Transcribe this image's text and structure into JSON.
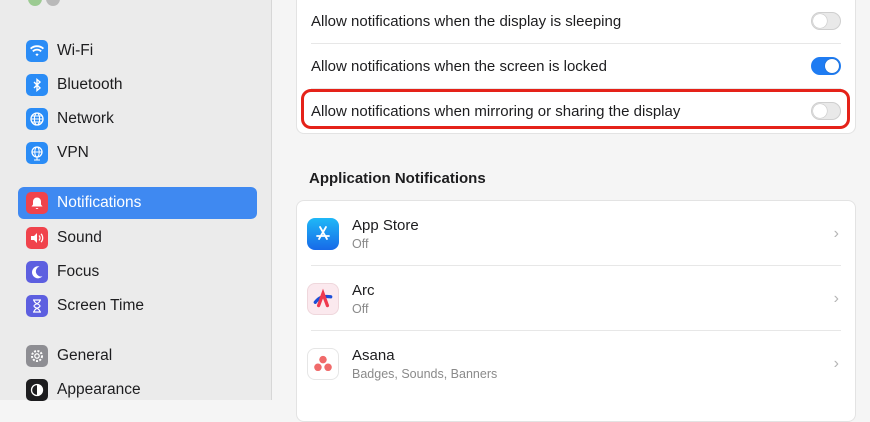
{
  "sidebar": {
    "items": [
      {
        "label": "Wi-Fi",
        "icon": "wifi-icon",
        "color": "#2a8cf6"
      },
      {
        "label": "Bluetooth",
        "icon": "bluetooth-icon",
        "color": "#2a8cf6"
      },
      {
        "label": "Network",
        "icon": "globe-icon",
        "color": "#2a8cf6"
      },
      {
        "label": "VPN",
        "icon": "vpn-globe-icon",
        "color": "#2a8cf6"
      },
      {
        "label": "Notifications",
        "icon": "bell-icon",
        "color": "#f0434c",
        "selected": true
      },
      {
        "label": "Sound",
        "icon": "speaker-icon",
        "color": "#f0434c"
      },
      {
        "label": "Focus",
        "icon": "moon-icon",
        "color": "#5d5fe0"
      },
      {
        "label": "Screen Time",
        "icon": "hourglass-icon",
        "color": "#5d5fe0"
      },
      {
        "label": "General",
        "icon": "gear-icon",
        "color": "#8e8e93"
      },
      {
        "label": "Appearance",
        "icon": "appearance-icon",
        "color": "#1d1d1f"
      }
    ]
  },
  "settings": [
    {
      "label": "Allow notifications when the display is sleeping",
      "on": false
    },
    {
      "label": "Allow notifications when the screen is locked",
      "on": true
    },
    {
      "label": "Allow notifications when mirroring or sharing the display",
      "on": false,
      "highlighted": true
    }
  ],
  "app_section": {
    "title": "Application Notifications",
    "apps": [
      {
        "name": "App Store",
        "status": "Off",
        "icon": "app-store-icon"
      },
      {
        "name": "Arc",
        "status": "Off",
        "icon": "arc-browser-icon"
      },
      {
        "name": "Asana",
        "status": "Badges, Sounds, Banners",
        "icon": "asana-icon"
      }
    ]
  },
  "colors": {
    "accent": "#3f89f1",
    "toggle_on": "#1f7cf2",
    "highlight": "#e52219"
  }
}
